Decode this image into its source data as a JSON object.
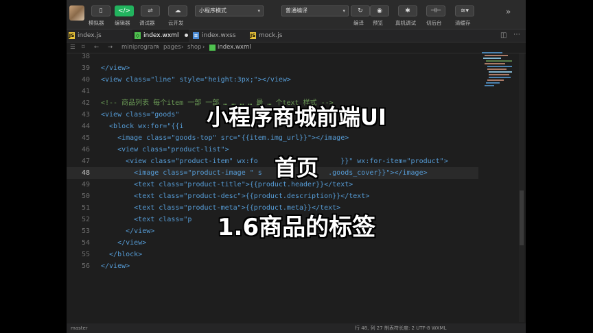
{
  "toolbar": {
    "buttons": [
      {
        "icon": "phone-icon",
        "label": "模拟器"
      },
      {
        "icon": "code-icon",
        "label": "编辑器"
      },
      {
        "icon": "debug-icon",
        "label": "调试器"
      },
      {
        "icon": "cloud-icon",
        "label": "云开发"
      }
    ],
    "mode_select": "小程序模式",
    "compile_select": "普通编译",
    "right_buttons": [
      {
        "icon": "compile-icon",
        "label": "编译"
      },
      {
        "icon": "preview-icon",
        "label": "预览"
      },
      {
        "icon": "bug-icon",
        "label": "真机调试"
      },
      {
        "icon": "switch-icon",
        "label": "切后台"
      },
      {
        "icon": "layers-icon",
        "label": "清缓存"
      }
    ],
    "expand_icon": "»",
    "accent_color": "#22b35e"
  },
  "tabs": [
    {
      "label": "index.js",
      "type": "js",
      "active": false
    },
    {
      "label": "index.wxml",
      "type": "wxml",
      "active": true
    },
    {
      "label": "index.wxss",
      "type": "wxss",
      "active": false
    },
    {
      "label": "mock.js",
      "type": "js",
      "active": false
    }
  ],
  "breadcrumb": [
    "miniprogram",
    "pages",
    "shop",
    "index.wxml"
  ],
  "editor": {
    "lines": [
      {
        "n": "38",
        "text": ""
      },
      {
        "n": "39",
        "text": "</view>"
      },
      {
        "n": "40",
        "text": "<view class=\"line\" style=\"height:3px;\"></view>"
      },
      {
        "n": "41",
        "text": ""
      },
      {
        "n": "42",
        "text": "<!-- 商品列表 每个item 一部 一部 … … … … 最 … 个text 样式 -->"
      },
      {
        "n": "43",
        "text": "<view class=\"goods\""
      },
      {
        "n": "44",
        "text": "  <block wx:for=\"{{i"
      },
      {
        "n": "45",
        "text": "    <image class=\"goods-top\" src=\"{{item.img_url}}\"></image>"
      },
      {
        "n": "46",
        "text": "    <view class=\"product-list\">"
      },
      {
        "n": "47",
        "text": "      <view class=\"product-item\" wx:fo                    }}\" wx:for-item=\"product\">"
      },
      {
        "n": "48",
        "text": "        <image class=\"product-image \" s                .goods_cover}}\"></image>"
      },
      {
        "n": "49",
        "text": "        <text class=\"product-title\">{{product.header}}</text>"
      },
      {
        "n": "50",
        "text": "        <text class=\"product-desc\">{{product.description}}</text>"
      },
      {
        "n": "51",
        "text": "        <text class=\"product-meta\">{{product.meta}}</text>"
      },
      {
        "n": "52",
        "text": "        <text class=\"p"
      },
      {
        "n": "53",
        "text": "      </view>"
      },
      {
        "n": "54",
        "text": "    </view>"
      },
      {
        "n": "55",
        "text": "  </block>"
      },
      {
        "n": "56",
        "text": "</view>"
      }
    ]
  },
  "overlay": {
    "title": "小程序商城前端UI",
    "subtitle": "首页",
    "lesson": "1.6商品的标签"
  },
  "statusbar": {
    "left": "master",
    "right": "行 48, 列 27   制表符长度: 2   UTF-8   WXML"
  }
}
